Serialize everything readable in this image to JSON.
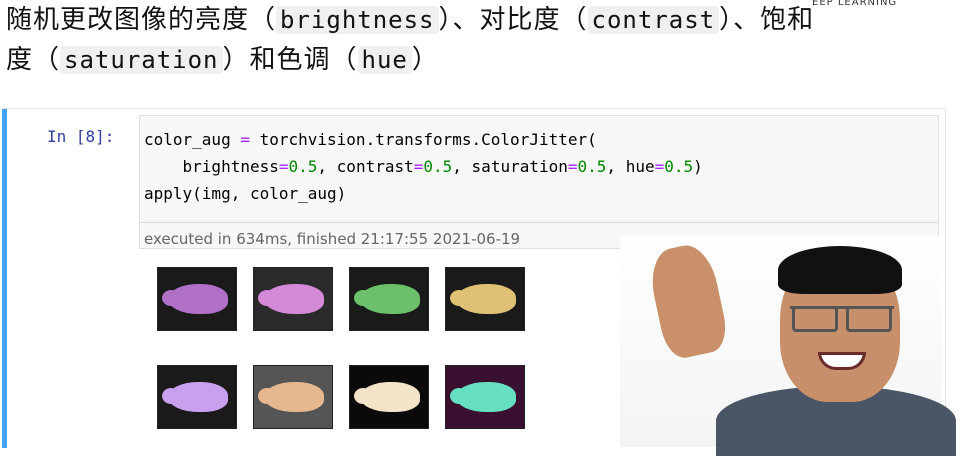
{
  "heading": {
    "line1_text": "随机更改图像的亮度（",
    "line1_code1": "brightness",
    "line1_mid": "）、对比度（",
    "line1_code2": "contrast",
    "line1_end": "）、饱和",
    "line2_start": "度（",
    "line2_code1": "saturation",
    "line2_mid": "）和色调（",
    "line2_code2": "hue",
    "line2_end": "）"
  },
  "brand_text": "EEP LEARNING",
  "cell": {
    "prompt": "In [8]:",
    "code": {
      "line1_a": "color_aug ",
      "line1_eq": "=",
      "line1_b": " torchvision.transforms.ColorJitter(",
      "line2_indent": "    ",
      "line2_p1": "brightness",
      "line2_v1": "0.5",
      "line2_p2": "contrast",
      "line2_v2": "0.5",
      "line2_p3": "saturation",
      "line2_v3": "0.5",
      "line2_p4": "hue",
      "line2_v4": "0.5",
      "eq": "=",
      "sep": ", ",
      "close": ")",
      "line3": "apply(img, color_aug)"
    },
    "execution": "executed in 634ms, finished 21:17:55 2021-06-19"
  },
  "thumbnails": [
    {
      "tint": "#b070c8",
      "bg": "#1a1a1a"
    },
    {
      "tint": "#d48ad8",
      "bg": "#2a2a2a"
    },
    {
      "tint": "#6cc06a",
      "bg": "#1a1a1a"
    },
    {
      "tint": "#e0c074",
      "bg": "#1a1a1a"
    },
    {
      "tint": "#c9a0ee",
      "bg": "#1a1a1a"
    },
    {
      "tint": "#e6b890",
      "bg": "#555555"
    },
    {
      "tint": "#f3e3c8",
      "bg": "#0a0a0a"
    },
    {
      "tint": "#66e0c0",
      "bg": "#3a1030"
    }
  ],
  "colors": {
    "cell_accent": "#42a5f5",
    "prompt": "#303f9f",
    "operator": "#aa22ff",
    "number": "#008800"
  }
}
